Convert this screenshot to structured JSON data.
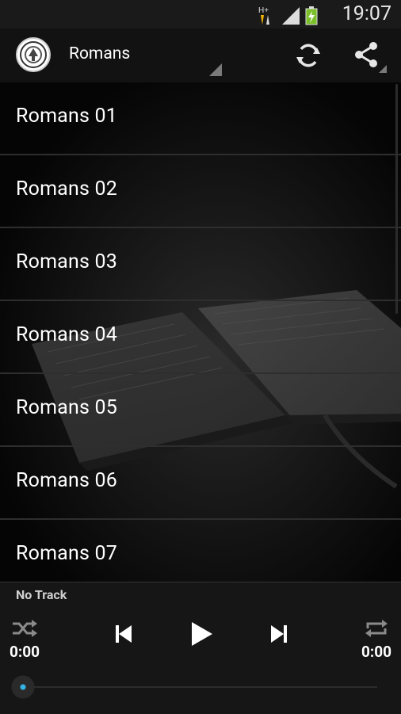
{
  "status_bar": {
    "time": "19:07",
    "icons": [
      "data-arrows-icon",
      "signal-icon",
      "battery-charging-icon"
    ],
    "network_label": "H+"
  },
  "action_bar": {
    "title": "Romans",
    "icons": [
      "app-logo",
      "refresh-icon",
      "share-icon"
    ]
  },
  "list": {
    "items": [
      {
        "label": "Romans 01"
      },
      {
        "label": "Romans 02"
      },
      {
        "label": "Romans 03"
      },
      {
        "label": "Romans 04"
      },
      {
        "label": "Romans 05"
      },
      {
        "label": "Romans 06"
      },
      {
        "label": "Romans 07"
      }
    ]
  },
  "player": {
    "track": "No Track",
    "elapsed": "0:00",
    "duration": "0:00",
    "progress": 0,
    "accent": "#33b5e5",
    "icons": [
      "shuffle-icon",
      "previous-icon",
      "play-icon",
      "next-icon",
      "repeat-icon"
    ]
  }
}
